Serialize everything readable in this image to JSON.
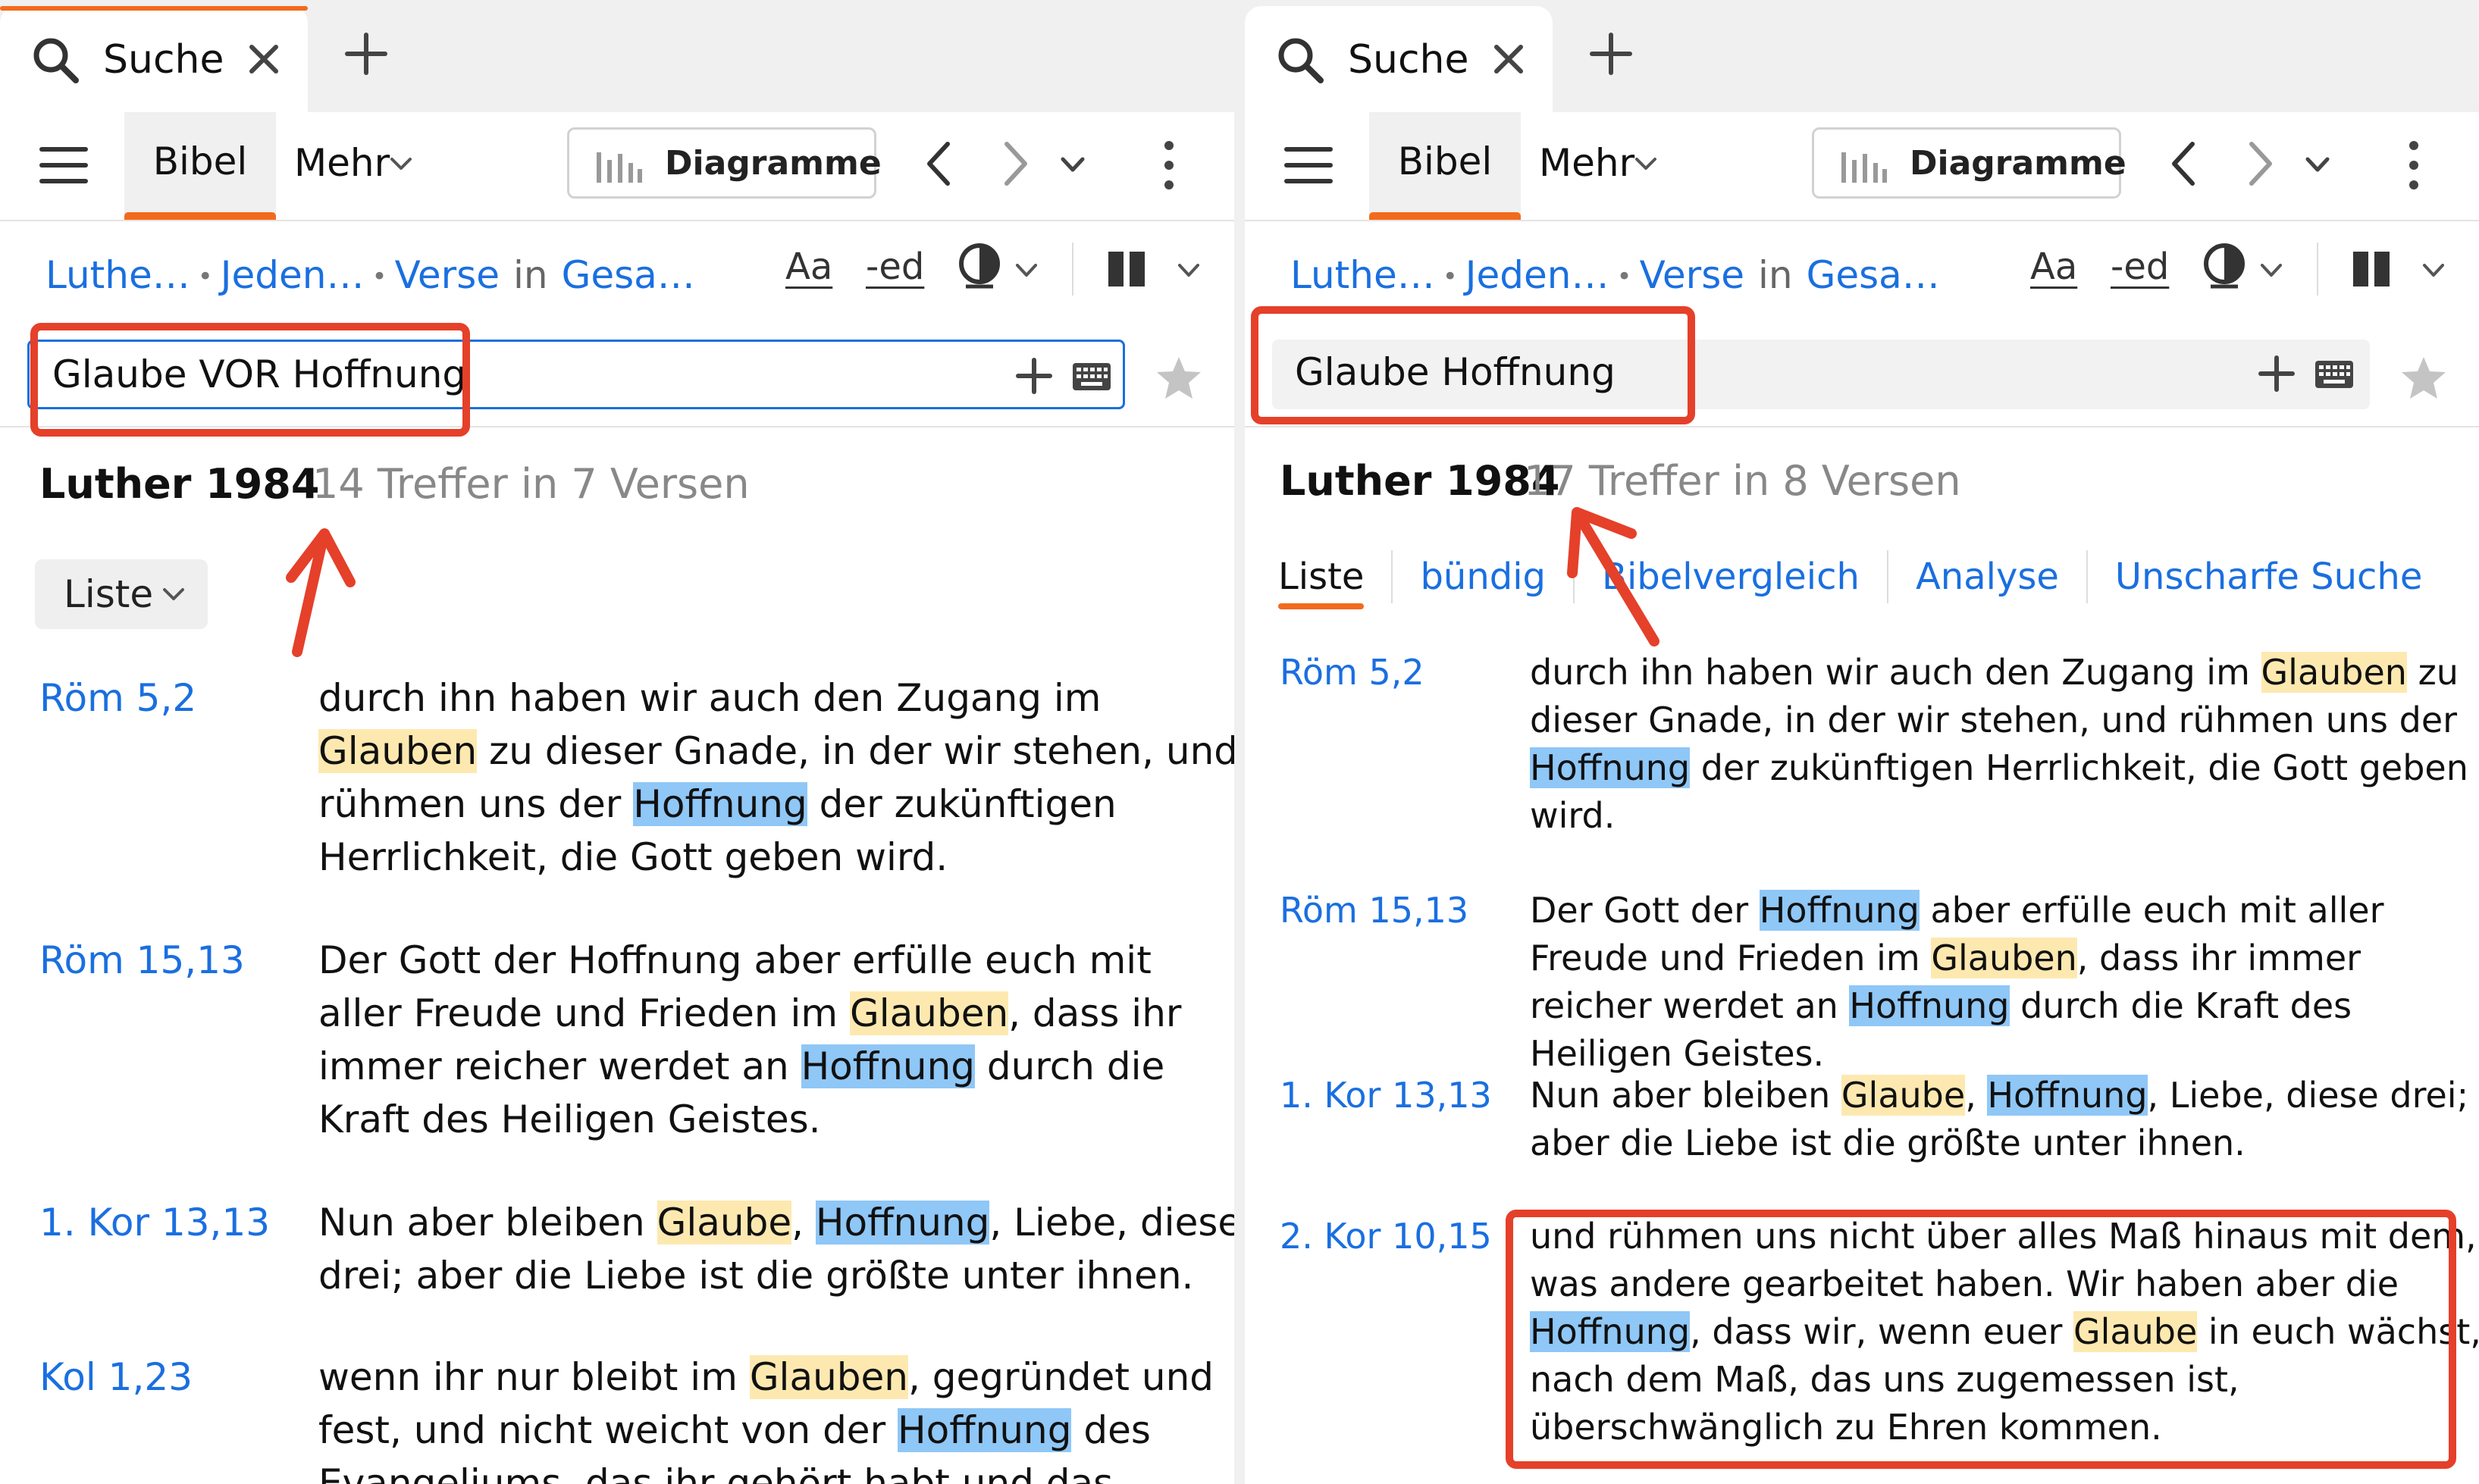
{
  "left_pane": {
    "tab": {
      "label": "Suche"
    },
    "toolbar": {
      "bibel_label": "Bibel",
      "mehr_label": "Mehr",
      "diagramme_label": "Diagramme"
    },
    "filters": {
      "translation": "Luthe…",
      "scope": "Jeden…",
      "verses": "Verse",
      "in": "in",
      "range": "Gesa…",
      "font_size": "Aa",
      "ed": "-ed"
    },
    "search": {
      "query": "Glaube VOR Hoffnung"
    },
    "results": {
      "title": "Luther 1984",
      "count": "14 Treffer in 7 Versen",
      "view_dropdown": "Liste"
    },
    "verses": [
      {
        "ref": "Röm 5,2",
        "parts": [
          {
            "t": "durch ihn haben wir auch den Zugang im "
          },
          {
            "t": "Glauben",
            "hl": "g"
          },
          {
            "t": " zu dieser Gnade, in der wir stehen, und rühmen uns der "
          },
          {
            "t": "Hoffnung",
            "hl": "h"
          },
          {
            "t": " der zukünftigen Herrlichkeit, die Gott geben wird."
          }
        ]
      },
      {
        "ref": "Röm 15,13",
        "parts": [
          {
            "t": "Der Gott der Hoffnung aber erfülle euch mit aller Freude und Frieden im "
          },
          {
            "t": "Glauben",
            "hl": "g"
          },
          {
            "t": ", dass ihr immer reicher werdet an "
          },
          {
            "t": "Hoffnung",
            "hl": "h"
          },
          {
            "t": " durch die Kraft des Heiligen Geistes."
          }
        ]
      },
      {
        "ref": "1. Kor 13,13",
        "parts": [
          {
            "t": "Nun aber bleiben "
          },
          {
            "t": "Glaube",
            "hl": "g"
          },
          {
            "t": ", "
          },
          {
            "t": "Hoffnung",
            "hl": "h"
          },
          {
            "t": ", Liebe, diese drei; aber die Liebe ist die größte unter ihnen."
          }
        ]
      },
      {
        "ref": "Kol 1,23",
        "parts": [
          {
            "t": "wenn ihr nur bleibt im "
          },
          {
            "t": "Glauben",
            "hl": "g"
          },
          {
            "t": ", gegründet und fest, und nicht weicht von der "
          },
          {
            "t": "Hoffnung",
            "hl": "h"
          },
          {
            "t": " des Evangeliums, das ihr gehört habt und das"
          }
        ]
      }
    ]
  },
  "right_pane": {
    "tab": {
      "label": "Suche"
    },
    "toolbar": {
      "bibel_label": "Bibel",
      "mehr_label": "Mehr",
      "diagramme_label": "Diagramme"
    },
    "filters": {
      "translation": "Luthe…",
      "scope": "Jeden…",
      "verses": "Verse",
      "in": "in",
      "range": "Gesa…",
      "font_size": "Aa",
      "ed": "-ed"
    },
    "search": {
      "query": "Glaube Hoffnung"
    },
    "results": {
      "title": "Luther 1984",
      "count": "17 Treffer in 8 Versen"
    },
    "view_tabs": [
      "Liste",
      "bündig",
      "Bibelvergleich",
      "Analyse",
      "Unscharfe Suche"
    ],
    "verses": [
      {
        "ref": "Röm 5,2",
        "parts": [
          {
            "t": "durch ihn haben wir auch den Zugang im "
          },
          {
            "t": "Glauben",
            "hl": "g"
          },
          {
            "t": " zu dieser Gnade, in der wir stehen, und rühmen uns der "
          },
          {
            "t": "Hoffnung",
            "hl": "h"
          },
          {
            "t": " der zukünftigen Herrlichkeit, die Gott geben wird."
          }
        ]
      },
      {
        "ref": "Röm 15,13",
        "parts": [
          {
            "t": "Der Gott der "
          },
          {
            "t": "Hoffnung",
            "hl": "h"
          },
          {
            "t": " aber erfülle euch mit aller Freude und Frieden im "
          },
          {
            "t": "Glauben",
            "hl": "g"
          },
          {
            "t": ", dass ihr immer reicher werdet an "
          },
          {
            "t": "Hoffnung",
            "hl": "h"
          },
          {
            "t": " durch die Kraft des Heiligen Geistes."
          }
        ]
      },
      {
        "ref": "1. Kor 13,13",
        "parts": [
          {
            "t": "Nun aber bleiben "
          },
          {
            "t": "Glaube",
            "hl": "g"
          },
          {
            "t": ", "
          },
          {
            "t": "Hoffnung",
            "hl": "h"
          },
          {
            "t": ", Liebe, diese drei; aber die Liebe ist die größte unter ihnen."
          }
        ]
      },
      {
        "ref": "2. Kor 10,15",
        "parts": [
          {
            "t": "und rühmen uns nicht über alles Maß hinaus mit dem, was andere gearbeitet haben. Wir haben aber die "
          },
          {
            "t": "Hoffnung",
            "hl": "h"
          },
          {
            "t": ", dass wir, wenn euer "
          },
          {
            "t": "Glaube",
            "hl": "g"
          },
          {
            "t": " in euch wächst, nach dem Maß, das uns zugemessen ist, überschwänglich zu Ehren kommen."
          }
        ]
      }
    ]
  },
  "colors": {
    "accent_orange": "#f26b1d",
    "link_blue": "#1a6fe0",
    "annotation_red": "#e5402a",
    "highlight_glaube": "#fde9b0",
    "highlight_hoffnung": "#8fc7f7"
  }
}
